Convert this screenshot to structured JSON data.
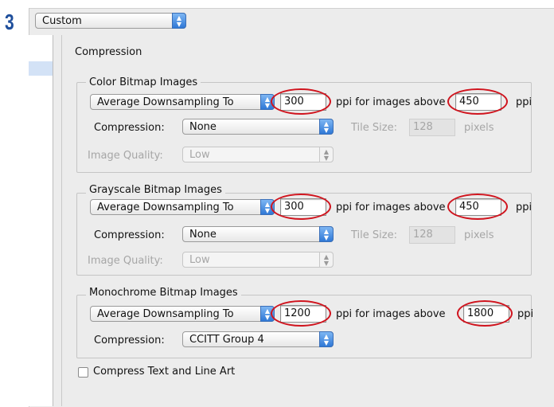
{
  "step_number": "3",
  "preset": {
    "value": "Custom"
  },
  "section_title": "Compression",
  "color_group": {
    "title": "Color Bitmap Images",
    "method": "Average Downsampling To",
    "resolution": "300",
    "mid_label": "ppi for images above",
    "threshold": "450",
    "unit": "ppi",
    "compression_label": "Compression:",
    "compression": "None",
    "tile_size_label": "Tile Size:",
    "tile_size": "128",
    "tile_unit": "pixels",
    "quality_label": "Image Quality:",
    "quality": "Low"
  },
  "grayscale_group": {
    "title": "Grayscale Bitmap Images",
    "method": "Average Downsampling To",
    "resolution": "300",
    "mid_label": "ppi for images above",
    "threshold": "450",
    "unit": "ppi",
    "compression_label": "Compression:",
    "compression": "None",
    "tile_size_label": "Tile Size:",
    "tile_size": "128",
    "tile_unit": "pixels",
    "quality_label": "Image Quality:",
    "quality": "Low"
  },
  "mono_group": {
    "title": "Monochrome Bitmap Images",
    "method": "Average Downsampling To",
    "resolution": "1200",
    "mid_label": "ppi for images above",
    "threshold": "1800",
    "unit": "ppi",
    "compression_label": "Compression:",
    "compression": "CCITT Group 4"
  },
  "compress_text": {
    "label": "Compress Text and Line Art",
    "checked": false
  },
  "colors": {
    "highlight": "#d0141e",
    "step": "#1f4f9c",
    "popup_arrow": "#2f78d6"
  }
}
